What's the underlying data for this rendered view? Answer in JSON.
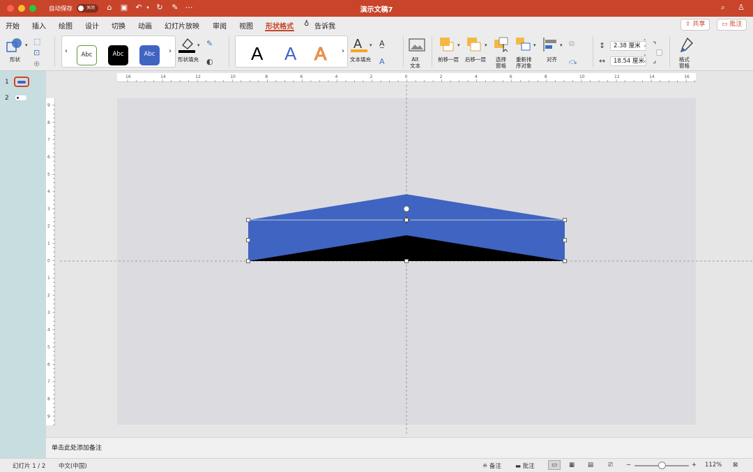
{
  "window": {
    "title": "演示文稿7",
    "autosave_label": "自动保存",
    "autosave_state": "关闭"
  },
  "tabs": [
    "开始",
    "插入",
    "绘图",
    "设计",
    "切换",
    "动画",
    "幻灯片放映",
    "审阅",
    "视图",
    "形状格式",
    "告诉我"
  ],
  "active_tab": "形状格式",
  "header_buttons": {
    "share": "共享",
    "comments": "批注"
  },
  "ribbon": {
    "shapes_label": "形状",
    "style_swatches": [
      "Abc",
      "Abc",
      "Abc"
    ],
    "shape_fill_label": "形状填充",
    "wordart_letters": [
      "A",
      "A",
      "A"
    ],
    "text_fill_label": "文本填充",
    "alt_text_label": "Alt\n文本",
    "bring_forward_label": "前移一层",
    "send_backward_label": "后移一层",
    "selection_pane_label": "选择\n窗格",
    "reorder_label": "重新排\n序对象",
    "align_label": "对齐",
    "height_value": "2.38 厘米",
    "width_value": "18.54 厘米",
    "format_pane_label": "格式\n窗格"
  },
  "ruler": {
    "horizontal_labels": [
      "16",
      "14",
      "12",
      "10",
      "8",
      "6",
      "4",
      "2",
      "0",
      "2",
      "4",
      "6",
      "8",
      "10",
      "12",
      "14",
      "16"
    ],
    "vertical_labels": [
      "9",
      "8",
      "7",
      "6",
      "5",
      "4",
      "3",
      "2",
      "1",
      "0",
      "1",
      "2",
      "3",
      "4",
      "5",
      "6",
      "7",
      "8",
      "9"
    ]
  },
  "thumbnails": [
    {
      "number": "1"
    },
    {
      "number": "2"
    }
  ],
  "notes_placeholder": "单击此处添加备注",
  "status": {
    "slide_info": "幻灯片 1 / 2",
    "language": "中文(中国)",
    "notes_label": "备注",
    "comments_label": "批注",
    "zoom": "112%"
  },
  "colors": {
    "brand": "#c8442a",
    "shape_blue": "#3f64c1",
    "shape_black": "#000000"
  }
}
